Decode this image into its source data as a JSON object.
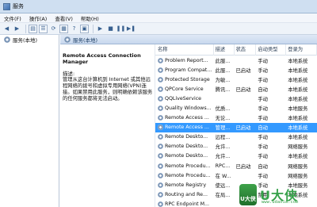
{
  "window": {
    "title": "服务"
  },
  "menu": [
    "文件(F)",
    "操作(A)",
    "查看(V)",
    "帮助(H)"
  ],
  "toolbar": {
    "buttons": [
      "back",
      "forward",
      "show-hide-tree",
      "list",
      "refresh",
      "export",
      "help",
      "properties",
      "start",
      "stop",
      "pause",
      "restart"
    ]
  },
  "tree": {
    "root_label": "服务(本地)"
  },
  "header": {
    "label": "服务(本地)"
  },
  "detail": {
    "service_name": "Remote Access Connection Manager",
    "description_label": "描述:",
    "description": "管理从这台计算机到 Internet 或其他远程网络的拨号和虚拟专用网络(VPN)连接。如果禁用此服务，则明确依赖该服务的任何服务都将无法启动。"
  },
  "list": {
    "columns": [
      "名称",
      "描述",
      "状态",
      "启动类型",
      "登录为"
    ],
    "rows": [
      {
        "name": "Problem Report...",
        "desc": "此服...",
        "status": "",
        "startup": "手动",
        "logon": "本地系统"
      },
      {
        "name": "Program Compat...",
        "desc": "此服...",
        "status": "已启动",
        "startup": "手动",
        "logon": "本地系统"
      },
      {
        "name": "Protected Storage",
        "desc": "为敏...",
        "status": "",
        "startup": "手动",
        "logon": "本地系统"
      },
      {
        "name": "QPCore Service",
        "desc": "腾讯...",
        "status": "已启动",
        "startup": "自动",
        "logon": "本地系统"
      },
      {
        "name": "QQLiveService",
        "desc": "",
        "status": "",
        "startup": "手动",
        "logon": "本地系统"
      },
      {
        "name": "Quality Windows...",
        "desc": "优质...",
        "status": "",
        "startup": "手动",
        "logon": "本地服务"
      },
      {
        "name": "Remote Access ...",
        "desc": "无论...",
        "status": "",
        "startup": "手动",
        "logon": "本地系统"
      },
      {
        "name": "Remote Access ...",
        "desc": "管理...",
        "status": "已启动",
        "startup": "自动",
        "logon": "本地系统",
        "selected": true
      },
      {
        "name": "Remote Deskto...",
        "desc": "远程...",
        "status": "",
        "startup": "手动",
        "logon": "本地系统"
      },
      {
        "name": "Remote Deskto...",
        "desc": "允许...",
        "status": "",
        "startup": "手动",
        "logon": "网络服务"
      },
      {
        "name": "Remote Deskto...",
        "desc": "允许...",
        "status": "",
        "startup": "手动",
        "logon": "本地系统"
      },
      {
        "name": "Remote Procedu...",
        "desc": "RPC...",
        "status": "已启动",
        "startup": "自动",
        "logon": "网络服务"
      },
      {
        "name": "Remote Procedu...",
        "desc": "在 W...",
        "status": "",
        "startup": "手动",
        "logon": "网络服务"
      },
      {
        "name": "Remote Registry",
        "desc": "使远...",
        "status": "",
        "startup": "手动",
        "logon": "本地服务"
      },
      {
        "name": "Routing and Re...",
        "desc": "在局...",
        "status": "",
        "startup": "禁用",
        "logon": "本地系统"
      },
      {
        "name": "RPC Endpoint M...",
        "desc": "",
        "status": "",
        "startup": "",
        "logon": ""
      }
    ]
  },
  "watermark": {
    "badge": "U大侠",
    "text": "U大侠",
    "url": "www.udaxia.com"
  },
  "colors": {
    "selection": "#3399ff",
    "titlebar": "#cfdff1",
    "watermark": "#36a14a"
  }
}
